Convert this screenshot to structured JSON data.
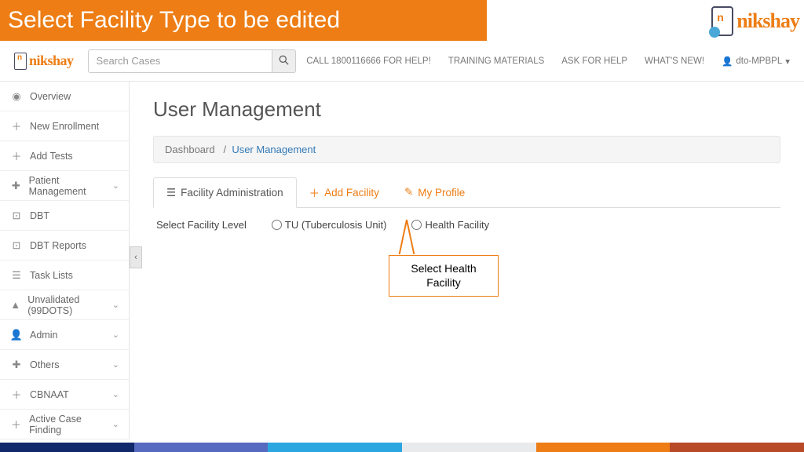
{
  "banner": {
    "title": "Select Facility Type to be edited"
  },
  "brand": {
    "name": "nikshay"
  },
  "search": {
    "placeholder": "Search Cases"
  },
  "topnav": {
    "help_phone": "CALL 1800116666 FOR HELP!",
    "training": "TRAINING MATERIALS",
    "ask": "ASK FOR HELP",
    "whats_new": "WHAT'S NEW!",
    "user": "dto-MPBPL"
  },
  "sidebar": {
    "items": [
      {
        "label": "Overview",
        "icon": "◉"
      },
      {
        "label": "New Enrollment",
        "icon": "＋"
      },
      {
        "label": "Add Tests",
        "icon": "＋"
      },
      {
        "label": "Patient Management",
        "icon": "✚",
        "expand": true
      },
      {
        "label": "DBT",
        "icon": "⊡"
      },
      {
        "label": "DBT Reports",
        "icon": "⊡"
      },
      {
        "label": "Task Lists",
        "icon": "☰"
      },
      {
        "label": "Unvalidated (99DOTS)",
        "icon": "▲",
        "expand": true
      },
      {
        "label": "Admin",
        "icon": "👤",
        "expand": true
      },
      {
        "label": "Others",
        "icon": "✚",
        "expand": true
      },
      {
        "label": "CBNAAT",
        "icon": "＋",
        "expand": true
      },
      {
        "label": "Active Case Finding",
        "icon": "＋",
        "expand": true
      }
    ]
  },
  "page": {
    "title": "User Management",
    "crumb_root": "Dashboard",
    "crumb_sep": "/",
    "crumb_current": "User Management"
  },
  "tabs": {
    "facility_admin": "Facility Administration",
    "add_facility": "Add Facility",
    "my_profile": "My Profile"
  },
  "form": {
    "select_level_label": "Select Facility Level",
    "opt_tu": "TU (Tuberculosis Unit)",
    "opt_hf": "Health Facility"
  },
  "callout": {
    "text": "Select Health Facility"
  }
}
